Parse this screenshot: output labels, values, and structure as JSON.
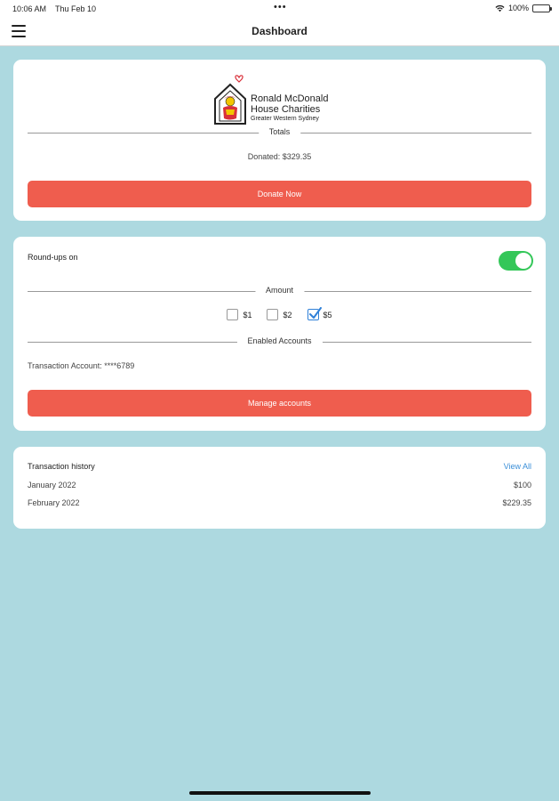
{
  "status_bar": {
    "time": "10:06 AM",
    "date": "Thu Feb 10",
    "more": "•••",
    "battery": "100%"
  },
  "nav": {
    "title": "Dashboard",
    "menu_icon": "hamburger-menu-icon"
  },
  "donation_card": {
    "logo": {
      "line1": "Ronald McDonald",
      "line2": "House Charities",
      "line3": "Greater Western Sydney"
    },
    "totals_label": "Totals",
    "donated_text": "Donated: $329.35",
    "donate_button": "Donate Now"
  },
  "roundups_card": {
    "roundups_label": "Round-ups on",
    "roundups_enabled": true,
    "amount_label": "Amount",
    "amounts": [
      {
        "label": "$1",
        "checked": false
      },
      {
        "label": "$2",
        "checked": false
      },
      {
        "label": "$5",
        "checked": true
      }
    ],
    "enabled_accounts_label": "Enabled Accounts",
    "account_text": "Transaction Account: ****6789",
    "manage_button": "Manage accounts"
  },
  "history_card": {
    "title": "Transaction history",
    "view_all": "View All",
    "rows": [
      {
        "month": "January 2022",
        "amount": "$100"
      },
      {
        "month": "February 2022",
        "amount": "$229.35"
      }
    ]
  },
  "colors": {
    "background": "#add9e0",
    "accent_button": "#ef5d4e",
    "toggle_on": "#34c759",
    "link": "#3b8fd8"
  }
}
